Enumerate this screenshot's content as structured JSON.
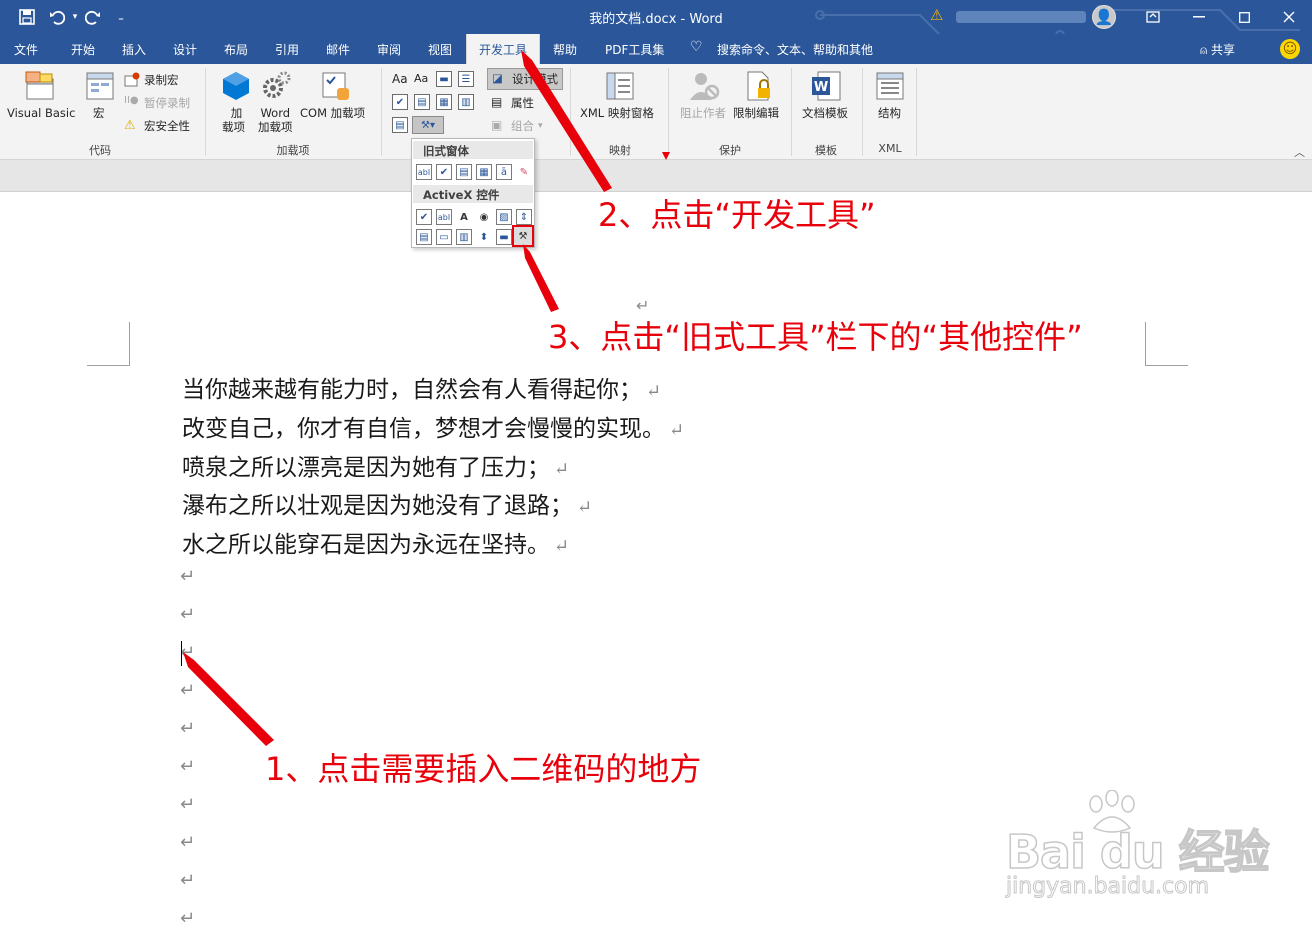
{
  "titlebar": {
    "title": "我的文档.docx  -  Word",
    "qa_save": "save-icon",
    "qa_undo": "undo-icon",
    "qa_redo": "redo-icon",
    "qa_more": "customize-icon"
  },
  "tabs": [
    "文件",
    "开始",
    "插入",
    "设计",
    "布局",
    "引用",
    "邮件",
    "审阅",
    "视图",
    "开发工具",
    "帮助",
    "PDF工具集"
  ],
  "search_hint": "搜索命令、文本、帮助和其他",
  "share_label": "共享",
  "ribbon": {
    "code": {
      "label": "代码",
      "visual_basic": "Visual Basic",
      "macro": "宏",
      "record_macro": "录制宏",
      "pause_record": "暂停录制",
      "macro_security": "宏安全性"
    },
    "addins": {
      "label": "加载项",
      "addin_l1": "加",
      "addin_l2": "载项",
      "word_addin_l1": "Word",
      "word_addin_l2": "加载项",
      "com_addin": "COM 加载项"
    },
    "controls": {
      "design_mode": "设计模式",
      "properties": "属性",
      "group": "组合"
    },
    "mapping": {
      "label": "映射",
      "xml_pane": "XML 映射窗格"
    },
    "protect": {
      "label": "保护",
      "block_authors": "阻止作者",
      "restrict_edit": "限制编辑"
    },
    "templates": {
      "label": "模板",
      "doc_template": "文档模板"
    },
    "xml": {
      "label": "XML",
      "structure": "结构"
    }
  },
  "dropdown": {
    "legacy_header": "旧式窗体",
    "activex_header": "ActiveX 控件"
  },
  "document": {
    "lines": [
      "当你越来越有能力时，自然会有人看得起你；",
      "改变自己，你才有自信，梦想才会慢慢的实现。",
      "喷泉之所以漂亮是因为她有了压力；",
      "瀑布之所以壮观是因为她没有了退路；",
      "水之所以能穿石是因为永远在坚持。"
    ],
    "para_mark": "↵"
  },
  "annotations": {
    "step1": "1、点击需要插入二维码的地方",
    "step2": "2、点击“开发工具”",
    "step3": "3、点击“旧式工具”栏下的“其他控件”",
    "color": "#e8000b"
  },
  "watermark": {
    "logo": "Bai du 经验",
    "sub": "jingyan.baidu.com"
  },
  "colors": {
    "word_blue": "#2b579a",
    "ribbon_bg": "#f3f3f3"
  }
}
